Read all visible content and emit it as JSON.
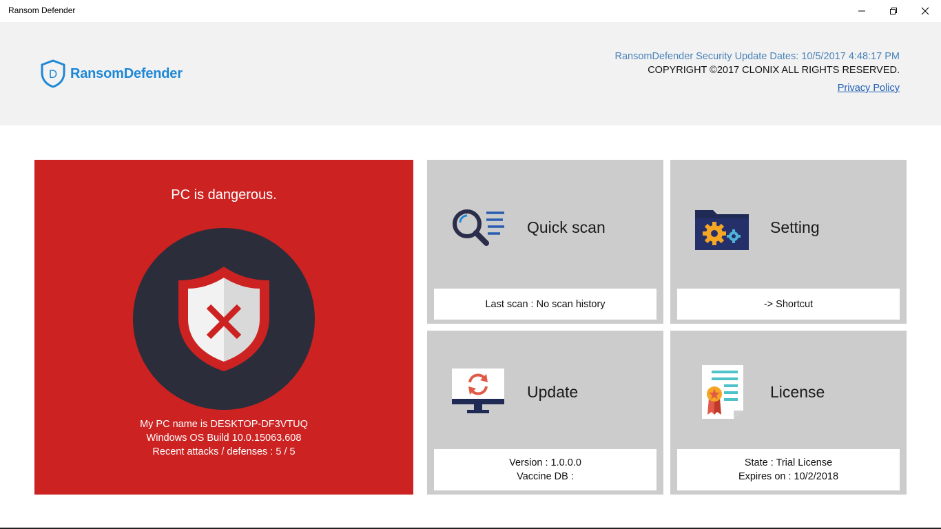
{
  "window": {
    "title": "Ransom Defender",
    "controls": [
      "minimize",
      "maximize",
      "close"
    ]
  },
  "header": {
    "brand": "RansomDefender",
    "update_dates": "RansomDefender Security Update Dates: 10/5/2017 4:48:17 PM",
    "copyright": "COPYRIGHT ©2017 CLONIX ALL RIGHTS RESERVED.",
    "privacy_link": "Privacy Policy"
  },
  "status": {
    "heading": "PC is dangerous.",
    "pc_name": "My PC name is DESKTOP-DF3VTUQ",
    "os_build": "Windows OS Build 10.0.15063.608",
    "attacks": "Recent attacks / defenses : 5 / 5",
    "icon": "shield-x-icon",
    "color": "#cc2222"
  },
  "tiles": {
    "quick_scan": {
      "title": "Quick scan",
      "info": "Last scan : No scan history",
      "icon": "scan-magnifier-icon"
    },
    "setting": {
      "title": "Setting",
      "info": "-> Shortcut",
      "icon": "folder-gears-icon"
    },
    "update": {
      "title": "Update",
      "version": "Version : 1.0.0.0",
      "vaccine": "Vaccine DB :",
      "icon": "monitor-refresh-icon"
    },
    "license": {
      "title": "License",
      "state": "State : Trial License",
      "expires": "Expires on : 10/2/2018",
      "icon": "certificate-icon"
    }
  },
  "colors": {
    "danger": "#cc2222",
    "brand": "#1e88d6",
    "tile_bg": "#cccccc",
    "header_bg": "#f2f2f2"
  }
}
